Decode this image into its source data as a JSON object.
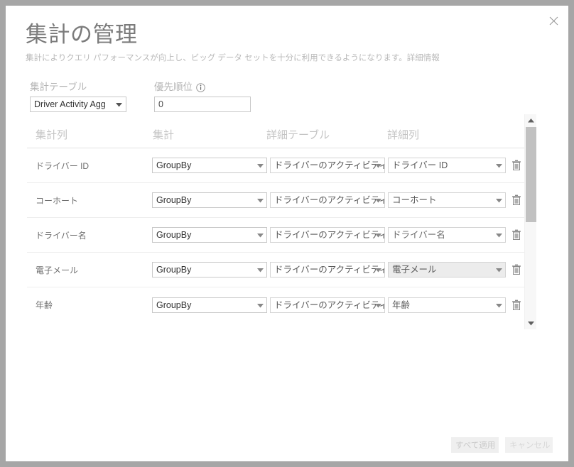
{
  "dialog": {
    "title": "集計の管理",
    "subtitle": "集計によりクエリ パフォーマンスが向上し、ビッグ データ セットを十分に利用できるようになります。詳細情報",
    "close_icon": "close-icon"
  },
  "selectors": {
    "agg_table_label": "集計テーブル",
    "agg_table_value": "Driver Activity Agg",
    "priority_label": "優先順位",
    "priority_info_icon": "info-icon",
    "priority_value": "0"
  },
  "grid": {
    "columns": [
      "集計列",
      "集計",
      "詳細テーブル",
      "詳細列"
    ],
    "rows": [
      {
        "name": "ドライバー ID",
        "aggregation": "GroupBy",
        "detail_table": "ドライバーのアクティビティ",
        "detail_column": "ドライバー ID",
        "delete_icon": "trash-icon"
      },
      {
        "name": "コーホート",
        "aggregation": "GroupBy",
        "detail_table": "ドライバーのアクティビティ",
        "detail_column": "コーホート",
        "delete_icon": "trash-icon"
      },
      {
        "name": "ドライバー名",
        "aggregation": "GroupBy",
        "detail_table": "ドライバーのアクティビティ",
        "detail_column": "ドライバー名",
        "delete_icon": "trash-icon"
      },
      {
        "name": "電子メール",
        "aggregation": "GroupBy",
        "detail_table": "ドライバーのアクティビティ",
        "detail_column": "電子メール",
        "delete_icon": "trash-icon"
      },
      {
        "name": "年齢",
        "aggregation": "GroupBy",
        "detail_table": "ドライバーのアクティビティ",
        "detail_column": "年齢",
        "delete_icon": "trash-icon"
      }
    ],
    "scrollbar": {
      "up_icon": "scroll-up-icon",
      "down_icon": "scroll-down-icon"
    }
  },
  "footer": {
    "apply_all_label": "すべて適用",
    "cancel_label": "キャンセル"
  },
  "colors": {
    "page_background": "#a6a6a6",
    "dialog_background": "#ffffff",
    "title_text": "#7b7b7b",
    "muted_text": "#c4c4c4",
    "field_border": "#c8c8c8",
    "disabled_button": "#efefef"
  }
}
